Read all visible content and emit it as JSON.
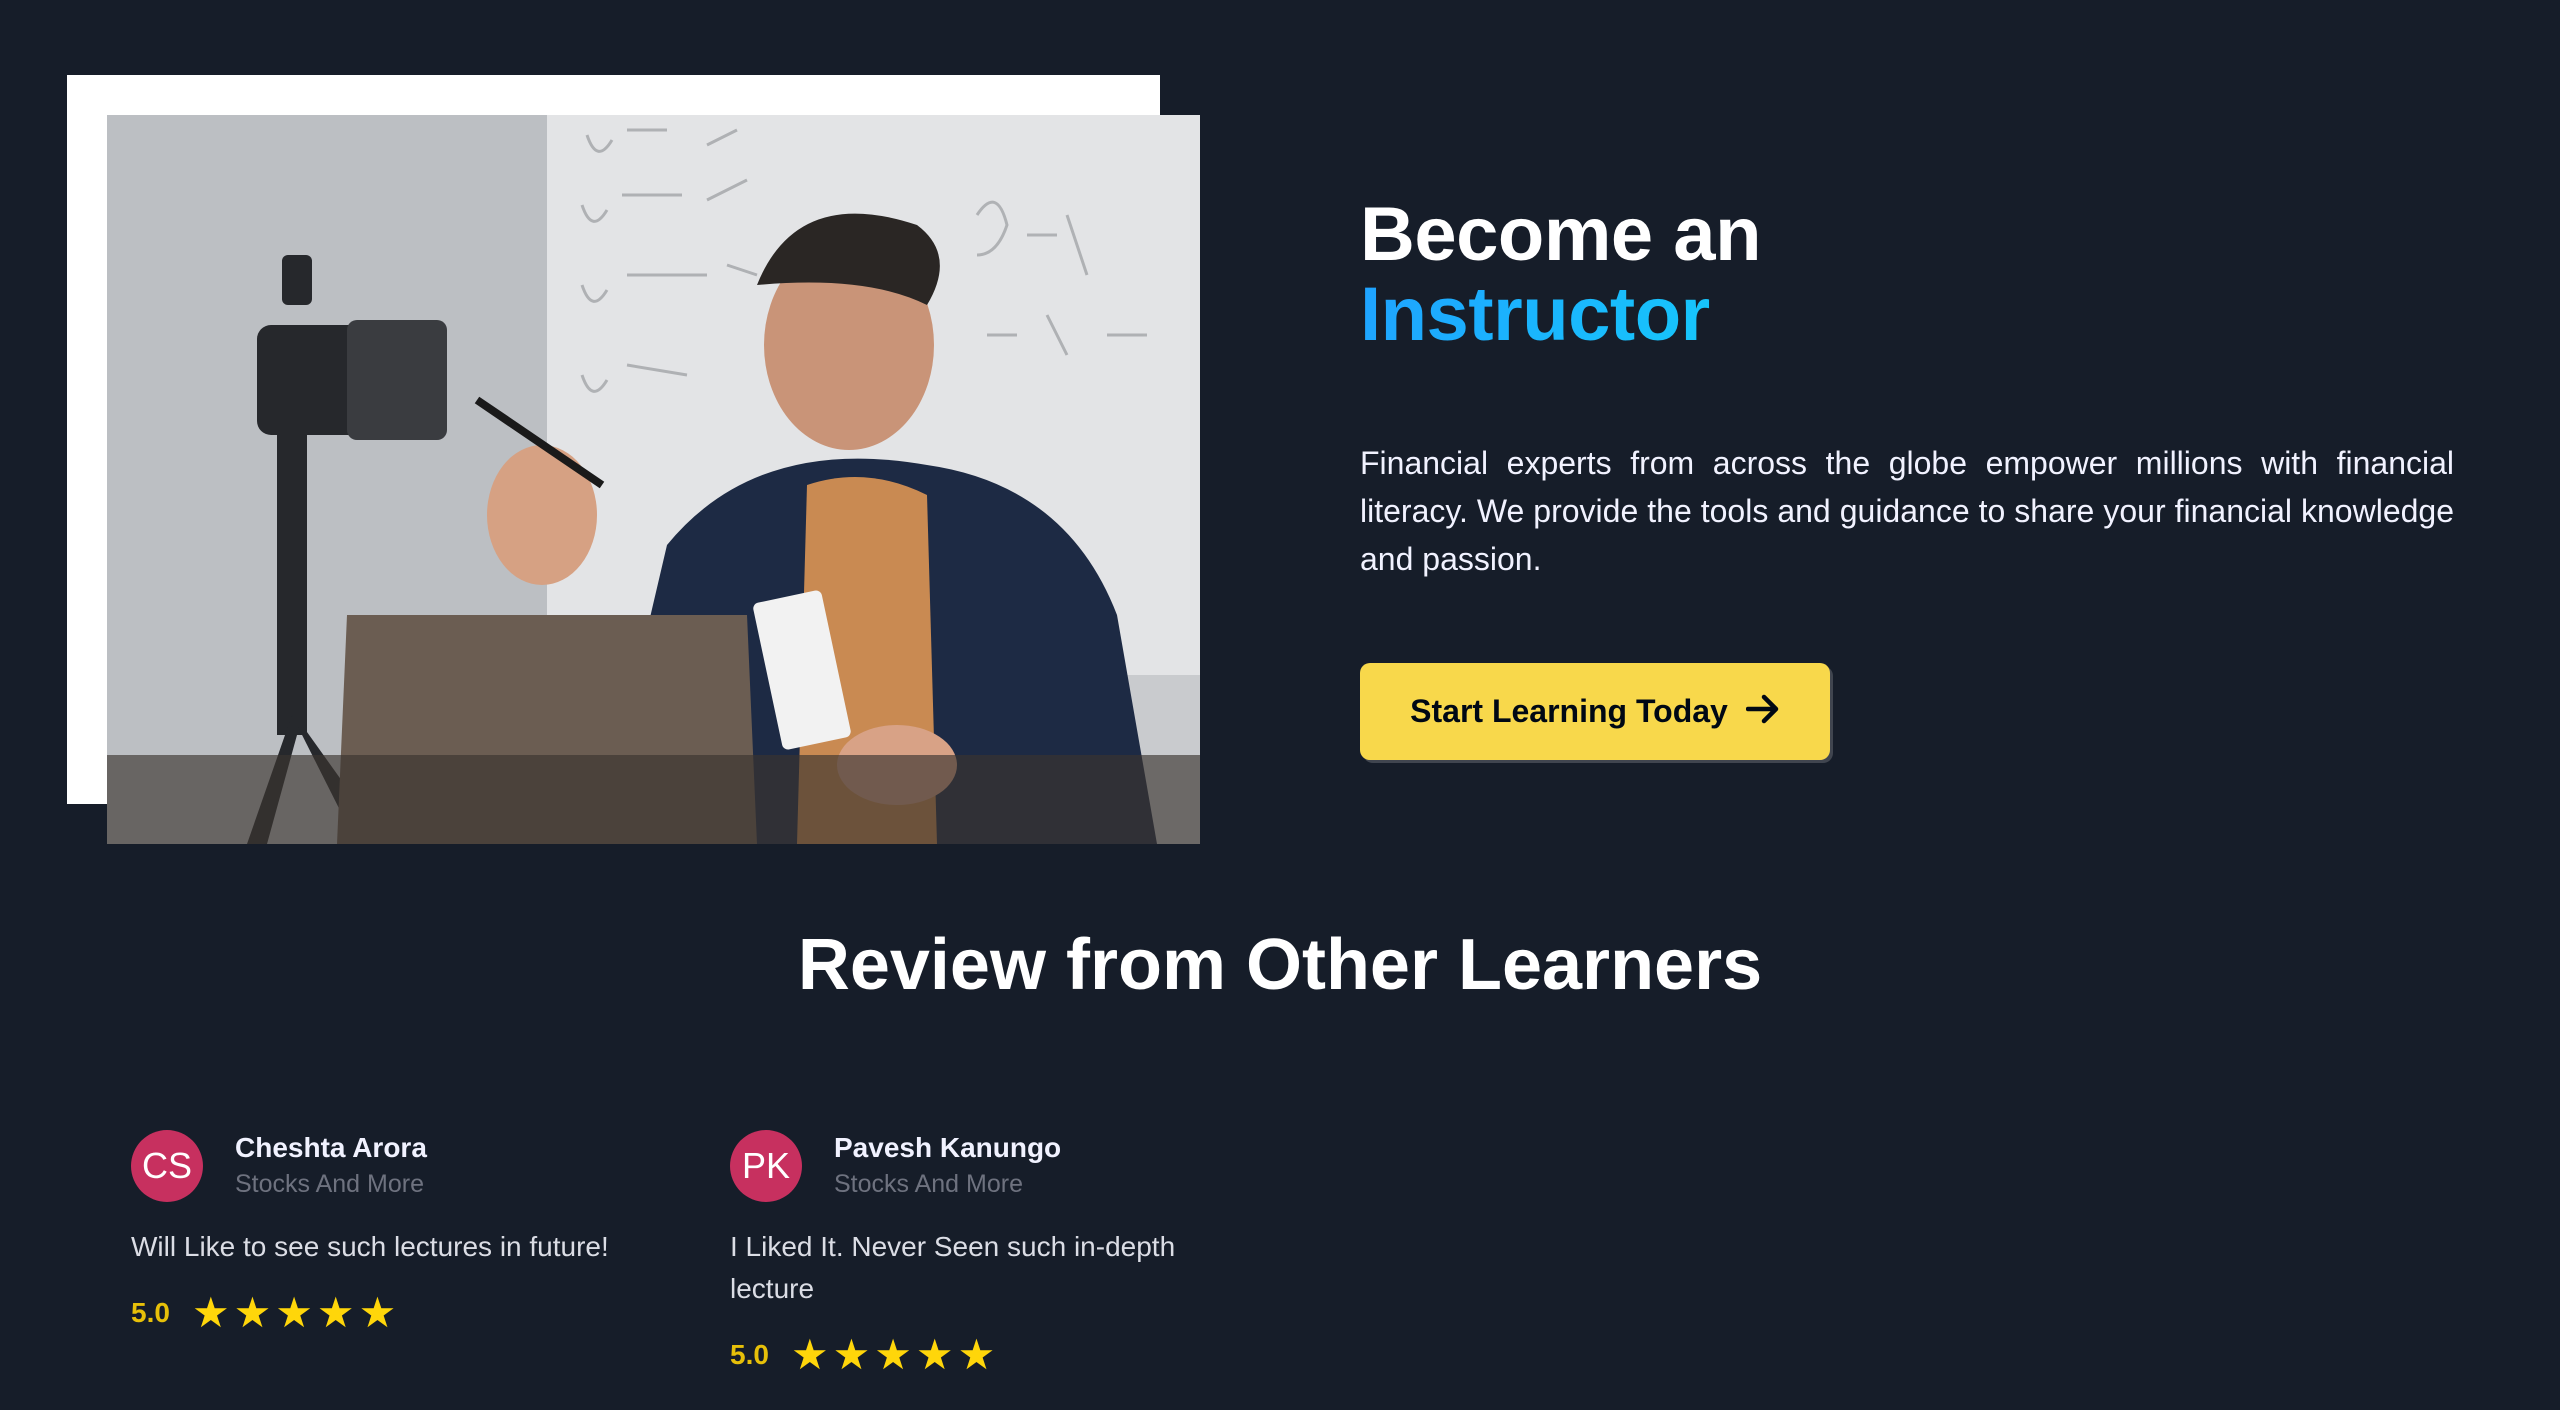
{
  "hero": {
    "title_line1": "Become an",
    "title_line2": "Instructor",
    "description": "Financial experts from across the globe empower millions with financial literacy. We provide the tools and guidance to share your financial knowledge and passion.",
    "cta_label": "Start Learning Today",
    "cta_icon": "arrow-right-icon",
    "photo_alt": "instructor-photo"
  },
  "reviews": {
    "title": "Review from Other Learners",
    "items": [
      {
        "initials": "CS",
        "name": "Cheshta Arora",
        "course": "Stocks And More",
        "text": "Will Like to see such lectures in future!",
        "score": "5.0",
        "stars": 5
      },
      {
        "initials": "PK",
        "name": "Pavesh Kanungo",
        "course": "Stocks And More",
        "text": "I Liked It. Never Seen such in-depth lecture",
        "score": "5.0",
        "stars": 5
      }
    ]
  },
  "colors": {
    "background": "#161d29",
    "accent_yellow": "#f8d84b",
    "avatar": "#c7305f",
    "gradient_accent": "#12d8fa"
  }
}
